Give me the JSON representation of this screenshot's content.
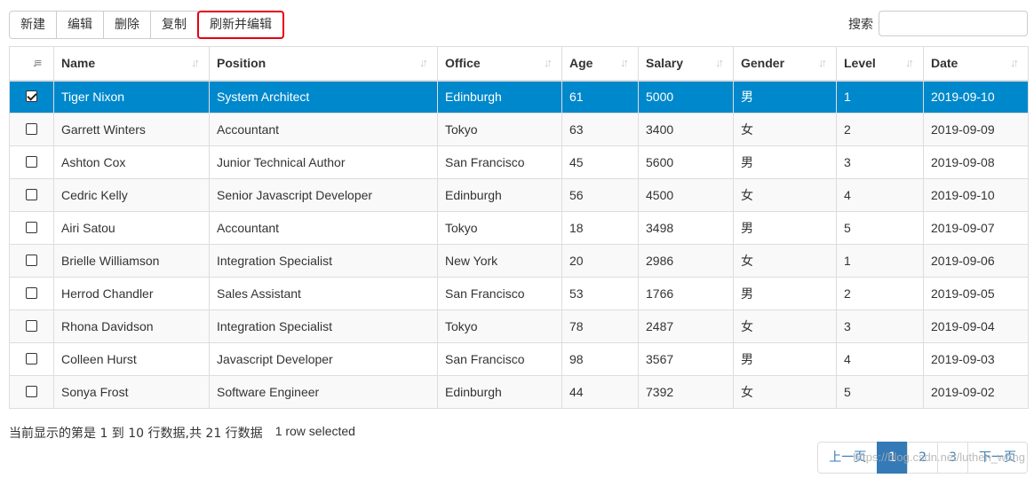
{
  "toolbar": {
    "buttons": [
      "新建",
      "编辑",
      "删除",
      "复制",
      "刷新并编辑"
    ]
  },
  "search": {
    "label": "搜索",
    "value": "",
    "placeholder": ""
  },
  "table": {
    "columns": [
      "Name",
      "Position",
      "Office",
      "Age",
      "Salary",
      "Gender",
      "Level",
      "Date"
    ],
    "rows": [
      {
        "selected": true,
        "cells": [
          "Tiger Nixon",
          "System Architect",
          "Edinburgh",
          "61",
          "5000",
          "男",
          "1",
          "2019-09-10"
        ]
      },
      {
        "selected": false,
        "cells": [
          "Garrett Winters",
          "Accountant",
          "Tokyo",
          "63",
          "3400",
          "女",
          "2",
          "2019-09-09"
        ]
      },
      {
        "selected": false,
        "cells": [
          "Ashton Cox",
          "Junior Technical Author",
          "San Francisco",
          "45",
          "5600",
          "男",
          "3",
          "2019-09-08"
        ]
      },
      {
        "selected": false,
        "cells": [
          "Cedric Kelly",
          "Senior Javascript Developer",
          "Edinburgh",
          "56",
          "4500",
          "女",
          "4",
          "2019-09-10"
        ]
      },
      {
        "selected": false,
        "cells": [
          "Airi Satou",
          "Accountant",
          "Tokyo",
          "18",
          "3498",
          "男",
          "5",
          "2019-09-07"
        ]
      },
      {
        "selected": false,
        "cells": [
          "Brielle Williamson",
          "Integration Specialist",
          "New York",
          "20",
          "2986",
          "女",
          "1",
          "2019-09-06"
        ]
      },
      {
        "selected": false,
        "cells": [
          "Herrod Chandler",
          "Sales Assistant",
          "San Francisco",
          "53",
          "1766",
          "男",
          "2",
          "2019-09-05"
        ]
      },
      {
        "selected": false,
        "cells": [
          "Rhona Davidson",
          "Integration Specialist",
          "Tokyo",
          "78",
          "2487",
          "女",
          "3",
          "2019-09-04"
        ]
      },
      {
        "selected": false,
        "cells": [
          "Colleen Hurst",
          "Javascript Developer",
          "San Francisco",
          "98",
          "3567",
          "男",
          "4",
          "2019-09-03"
        ]
      },
      {
        "selected": false,
        "cells": [
          "Sonya Frost",
          "Software Engineer",
          "Edinburgh",
          "44",
          "7392",
          "女",
          "5",
          "2019-09-02"
        ]
      }
    ]
  },
  "info": {
    "summary": "当前显示的第是 1 到 10 行数据,共 21 行数据",
    "selection": "1 row selected"
  },
  "pagination": {
    "prev": "上一页",
    "pages": [
      "1",
      "2",
      "3"
    ],
    "current": "1",
    "next": "下一页"
  },
  "watermark": "https://blog.csdn.net/luthen_wang",
  "colors": {
    "selected_row": "#0088cc",
    "highlight_border": "#e60012",
    "link": "#337ab7"
  }
}
